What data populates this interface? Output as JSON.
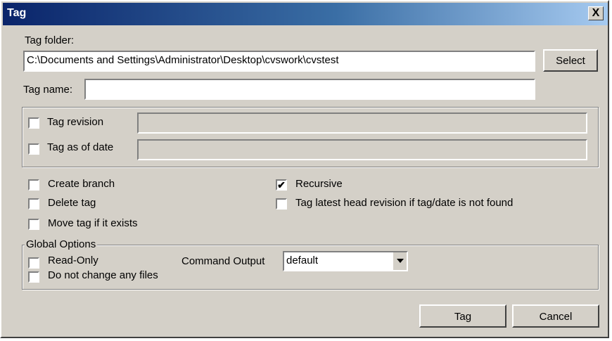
{
  "window": {
    "title": "Tag",
    "close_glyph": "X"
  },
  "tag_folder": {
    "label": "Tag folder:",
    "value": "C:\\Documents and Settings\\Administrator\\Desktop\\cvswork\\cvstest",
    "select_label": "Select"
  },
  "tag_name": {
    "label": "Tag name:",
    "value": ""
  },
  "revision_group": {
    "tag_revision": {
      "label": "Tag revision",
      "checked": false,
      "value": ""
    },
    "tag_as_of_date": {
      "label": "Tag as of date",
      "checked": false,
      "value": ""
    }
  },
  "options": {
    "create_branch": {
      "label": "Create branch",
      "checked": false
    },
    "delete_tag": {
      "label": "Delete tag",
      "checked": false
    },
    "move_tag": {
      "label": "Move tag if it exists",
      "checked": false
    },
    "recursive": {
      "label": "Recursive",
      "checked": true
    },
    "tag_latest_head": {
      "label": "Tag latest head revision if tag/date is not found",
      "checked": false
    }
  },
  "global_options": {
    "legend": "Global Options",
    "read_only": {
      "label": "Read-Only",
      "checked": false
    },
    "no_change_files": {
      "label": "Do not change any files",
      "checked": false
    },
    "command_output_label": "Command Output",
    "command_output_value": "default"
  },
  "buttons": {
    "tag": "Tag",
    "cancel": "Cancel"
  },
  "icons": {
    "check": "checkmark-icon",
    "close": "close-icon",
    "dropdown": "chevron-down-icon"
  }
}
